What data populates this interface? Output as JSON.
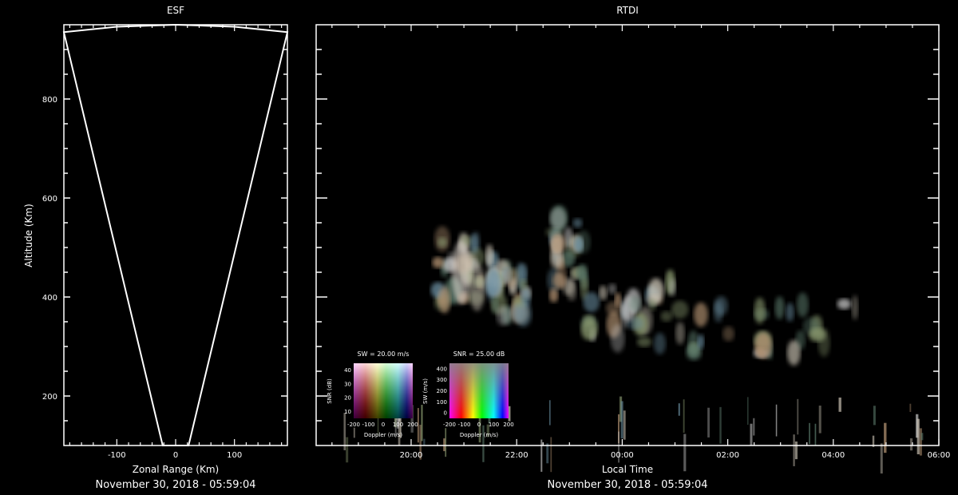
{
  "esf": {
    "title": "ESF",
    "xlabel": "Zonal Range (Km)",
    "ylabel": "Altitude (Km)",
    "timestamp": "November 30, 2018 - 05:59:04"
  },
  "rtdi": {
    "title": "RTDI",
    "xlabel": "Local Time",
    "timestamp": "November 30, 2018 - 05:59:04"
  },
  "legend_sw": {
    "title": "SW = 20.00 m/s",
    "xlabel": "Doppler (m/s)",
    "ylabel": "SNR (dB)",
    "xticks": [
      "-200",
      "-100",
      "0",
      "100",
      "200"
    ],
    "yticks": [
      "10",
      "20",
      "30",
      "40"
    ]
  },
  "legend_snr": {
    "title": "SNR = 25.00 dB",
    "xlabel": "Doppler (m/s)",
    "ylabel": "SW (m/s)",
    "xticks": [
      "-200",
      "-100",
      "0",
      "100",
      "200"
    ],
    "yticks": [
      "0",
      "100",
      "200",
      "300",
      "400"
    ]
  },
  "colors": {
    "background": "#000000",
    "axes": "#ffffff",
    "beam": "#ffffff"
  },
  "chart_data": [
    {
      "type": "line",
      "title": "ESF",
      "xlabel": "Zonal Range (Km)",
      "ylabel": "Altitude (Km)",
      "xlim": [
        -190,
        190
      ],
      "ylim": [
        100,
        950
      ],
      "xticks": [
        -100,
        0,
        100
      ],
      "yticks": [
        200,
        400,
        600,
        800
      ],
      "grid": false,
      "series": [
        {
          "x": [
            -190,
            -22,
            22,
            190
          ],
          "y": [
            935,
            100,
            100,
            935
          ]
        }
      ],
      "arc_top": {
        "x": [
          -190,
          -100,
          0,
          100,
          190
        ],
        "y": [
          935,
          946,
          950,
          946,
          935
        ]
      }
    },
    {
      "type": "heatmap",
      "title": "RTDI",
      "xlabel": "Local Time",
      "xticks": [
        "20:00",
        "22:00",
        "00:00",
        "02:00",
        "04:00",
        "06:00"
      ],
      "xlim_hours": [
        18.2,
        30.0
      ],
      "ylim": [
        100,
        950
      ],
      "yticks": [
        200,
        400,
        600,
        800
      ],
      "grid": false,
      "echo_regions": [
        {
          "t_start": 20.5,
          "t_end": 21.6,
          "alt_min": 380,
          "alt_max": 520
        },
        {
          "t_start": 21.5,
          "t_end": 22.2,
          "alt_min": 360,
          "alt_max": 460
        },
        {
          "t_start": 22.7,
          "t_end": 23.3,
          "alt_min": 400,
          "alt_max": 560
        },
        {
          "t_start": 23.2,
          "t_end": 25.0,
          "alt_min": 300,
          "alt_max": 430
        },
        {
          "t_start": 25.0,
          "t_end": 28.5,
          "alt_min": 280,
          "alt_max": 400
        },
        {
          "t_start": 18.5,
          "t_end": 29.8,
          "alt_min": 100,
          "alt_max": 200
        }
      ]
    }
  ]
}
